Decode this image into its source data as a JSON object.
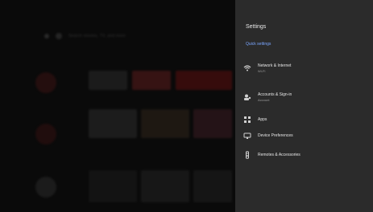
{
  "settings": {
    "title": "Settings",
    "subtitle": "Quick settings",
    "items": [
      {
        "label": "Network & Internet",
        "sub": "Wi-Fi",
        "icon": "wifi-icon"
      },
      {
        "label": "Accounts & Sign-in",
        "sub": "Account",
        "icon": "accounts-icon"
      },
      {
        "label": "Apps",
        "sub": "",
        "icon": "apps-icon"
      },
      {
        "label": "Device Preferences",
        "sub": "",
        "icon": "display-icon"
      },
      {
        "label": "Remotes & Accessories",
        "sub": "",
        "icon": "remote-icon"
      }
    ]
  },
  "background": {
    "search_placeholder": "Search movies, TV, and more"
  },
  "colors": {
    "panel": "#2b2b2b",
    "accent": "#7aa6ff"
  }
}
